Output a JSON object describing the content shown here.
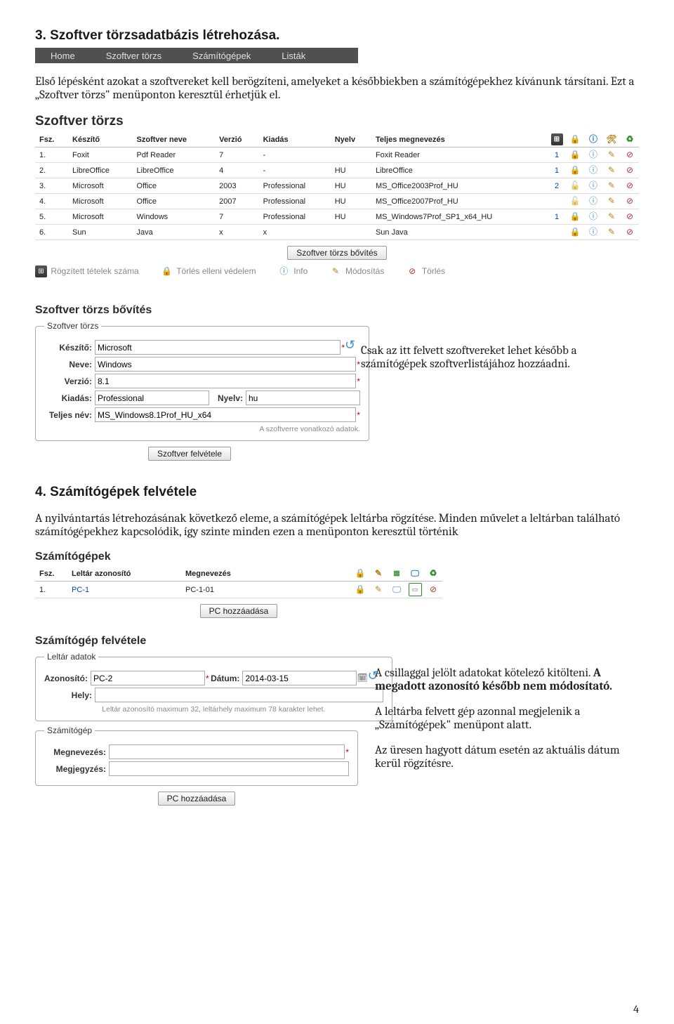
{
  "heading3": "3.   Szoftver törzsadatbázis létrehozása.",
  "menu": {
    "home": "Home",
    "torzs": "Szoftver törzs",
    "gepek": "Számítógépek",
    "listak": "Listák"
  },
  "para1": "Első lépésként azokat a szoftvereket kell berögzíteni, amelyeket a későbbiekben a számítógépekhez kívánunk társítani. Ezt a „Szoftver törzs\" menüponton keresztül érhetjük el.",
  "st_title": "Szoftver törzs",
  "st_headers": {
    "fsz": "Fsz.",
    "keszito": "Készítő",
    "neve": "Szoftver neve",
    "verzio": "Verzió",
    "kiadas": "Kiadás",
    "nyelv": "Nyelv",
    "teljes": "Teljes megnevezés"
  },
  "st_rows": [
    {
      "fsz": "1.",
      "keszito": "Foxit",
      "neve": "Pdf Reader",
      "verzio": "7",
      "kiadas": "-",
      "nyelv": "",
      "teljes": "Foxit Reader",
      "cnt": "1",
      "locked": true
    },
    {
      "fsz": "2.",
      "keszito": "LibreOffice",
      "neve": "LibreOffice",
      "verzio": "4",
      "kiadas": "-",
      "nyelv": "HU",
      "teljes": "LibreOffice",
      "cnt": "1",
      "locked": true
    },
    {
      "fsz": "3.",
      "keszito": "Microsoft",
      "neve": "Office",
      "verzio": "2003",
      "kiadas": "Professional",
      "nyelv": "HU",
      "teljes": "MS_Office2003Prof_HU",
      "cnt": "2",
      "locked": false
    },
    {
      "fsz": "4.",
      "keszito": "Microsoft",
      "neve": "Office",
      "verzio": "2007",
      "kiadas": "Professional",
      "nyelv": "HU",
      "teljes": "MS_Office2007Prof_HU",
      "cnt": "",
      "locked": false
    },
    {
      "fsz": "5.",
      "keszito": "Microsoft",
      "neve": "Windows",
      "verzio": "7",
      "kiadas": "Professional",
      "nyelv": "HU",
      "teljes": "MS_Windows7Prof_SP1_x64_HU",
      "cnt": "1",
      "locked": true
    },
    {
      "fsz": "6.",
      "keszito": "Sun",
      "neve": "Java",
      "verzio": "x",
      "kiadas": "x",
      "nyelv": "",
      "teljes": "Sun Java",
      "cnt": "",
      "locked": true
    }
  ],
  "btn_bovites": "Szoftver törzs bővítés",
  "legend": {
    "count": "Rögzített tételek száma",
    "lock": "Törlés elleni védelem",
    "info": "Info",
    "edit": "Módosítás",
    "del": "Törlés"
  },
  "stb_title": "Szoftver törzs bővítés",
  "stb_legend": "Szoftver törzs",
  "stb_fields": {
    "keszito": {
      "label": "Készítő:",
      "val": "Microsoft"
    },
    "neve": {
      "label": "Neve:",
      "val": "Windows"
    },
    "verzio": {
      "label": "Verzió:",
      "val": "8.1"
    },
    "kiadas": {
      "label": "Kiadás:",
      "val": "Professional"
    },
    "nyelv": {
      "label": "Nyelv:",
      "val": "hu"
    },
    "teljes": {
      "label": "Teljes név:",
      "val": "MS_Windows8.1Prof_HU_x64"
    }
  },
  "stb_note": "A szoftverre vonatkozó adatok.",
  "btn_felvetele": "Szoftver felvétele",
  "para2": "Csak az itt felvett szoftvereket lehet később a számítógépek szoftverlistájához hozzáadni.",
  "heading4": "4.   Számítógépek felvétele",
  "para3": "A nyilvántartás létrehozásának következő eleme, a számítógépek leltárba rögzítése. Minden művelet a leltárban található számítógépekhez kapcsolódik,  így szinte minden ezen a menüponton keresztül történik",
  "pc_title": "Számítógépek",
  "pc_headers": {
    "fsz": "Fsz.",
    "azon": "Leltár azonosító",
    "megn": "Megnevezés"
  },
  "pc_rows": [
    {
      "fsz": "1.",
      "azon": "PC-1",
      "megn": "PC-1-01"
    }
  ],
  "btn_pc_add": "PC hozzáadása",
  "pcf_title": "Számítógép felvétele",
  "pcf_legend1": "Leltár adatok",
  "pcf_fields": {
    "azon": {
      "label": "Azonosító:",
      "val": "PC-2"
    },
    "hely": {
      "label": "Hely:",
      "val": ""
    },
    "datum": {
      "label": "Dátum:",
      "val": "2014-03-15"
    }
  },
  "pcf_note": "Leltár azonosító maximum 32, leltárhely maximum 78 karakter lehet.",
  "pcf_legend2": "Számítógép",
  "pcf_fields2": {
    "megn": {
      "label": "Megnevezés:",
      "val": ""
    },
    "megj": {
      "label": "Megjegyzés:",
      "val": ""
    }
  },
  "para4a": " A csillaggal jelölt adatokat kötelező kitölteni.  ",
  "para4b": "A megadott azonosító később nem módosítató.",
  "para5": "A leltárba felvett gép azonnal megjelenik a „Számítógépek\" menüpont alatt.",
  "para6": "Az üresen hagyott dátum esetén az aktuális dátum kerül rögzítésre.",
  "pagenum": "4"
}
